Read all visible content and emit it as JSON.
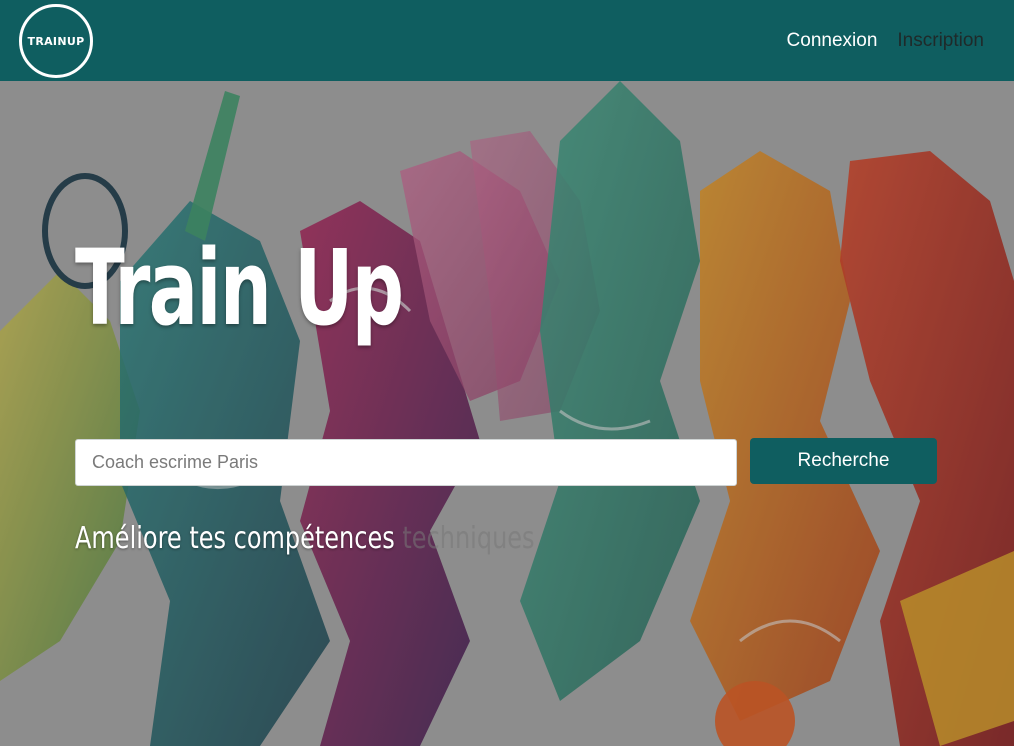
{
  "brand": {
    "logo_text": "TRAINUP"
  },
  "nav": {
    "login": "Connexion",
    "signup": "Inscription"
  },
  "hero": {
    "title": "Train Up",
    "search_placeholder": "Coach escrime Paris",
    "search_button": "Recherche",
    "tagline_main": "Améliore tes compétences",
    "tagline_faded": "techniques"
  },
  "colors": {
    "primary": "#0f5e60",
    "white": "#ffffff"
  }
}
